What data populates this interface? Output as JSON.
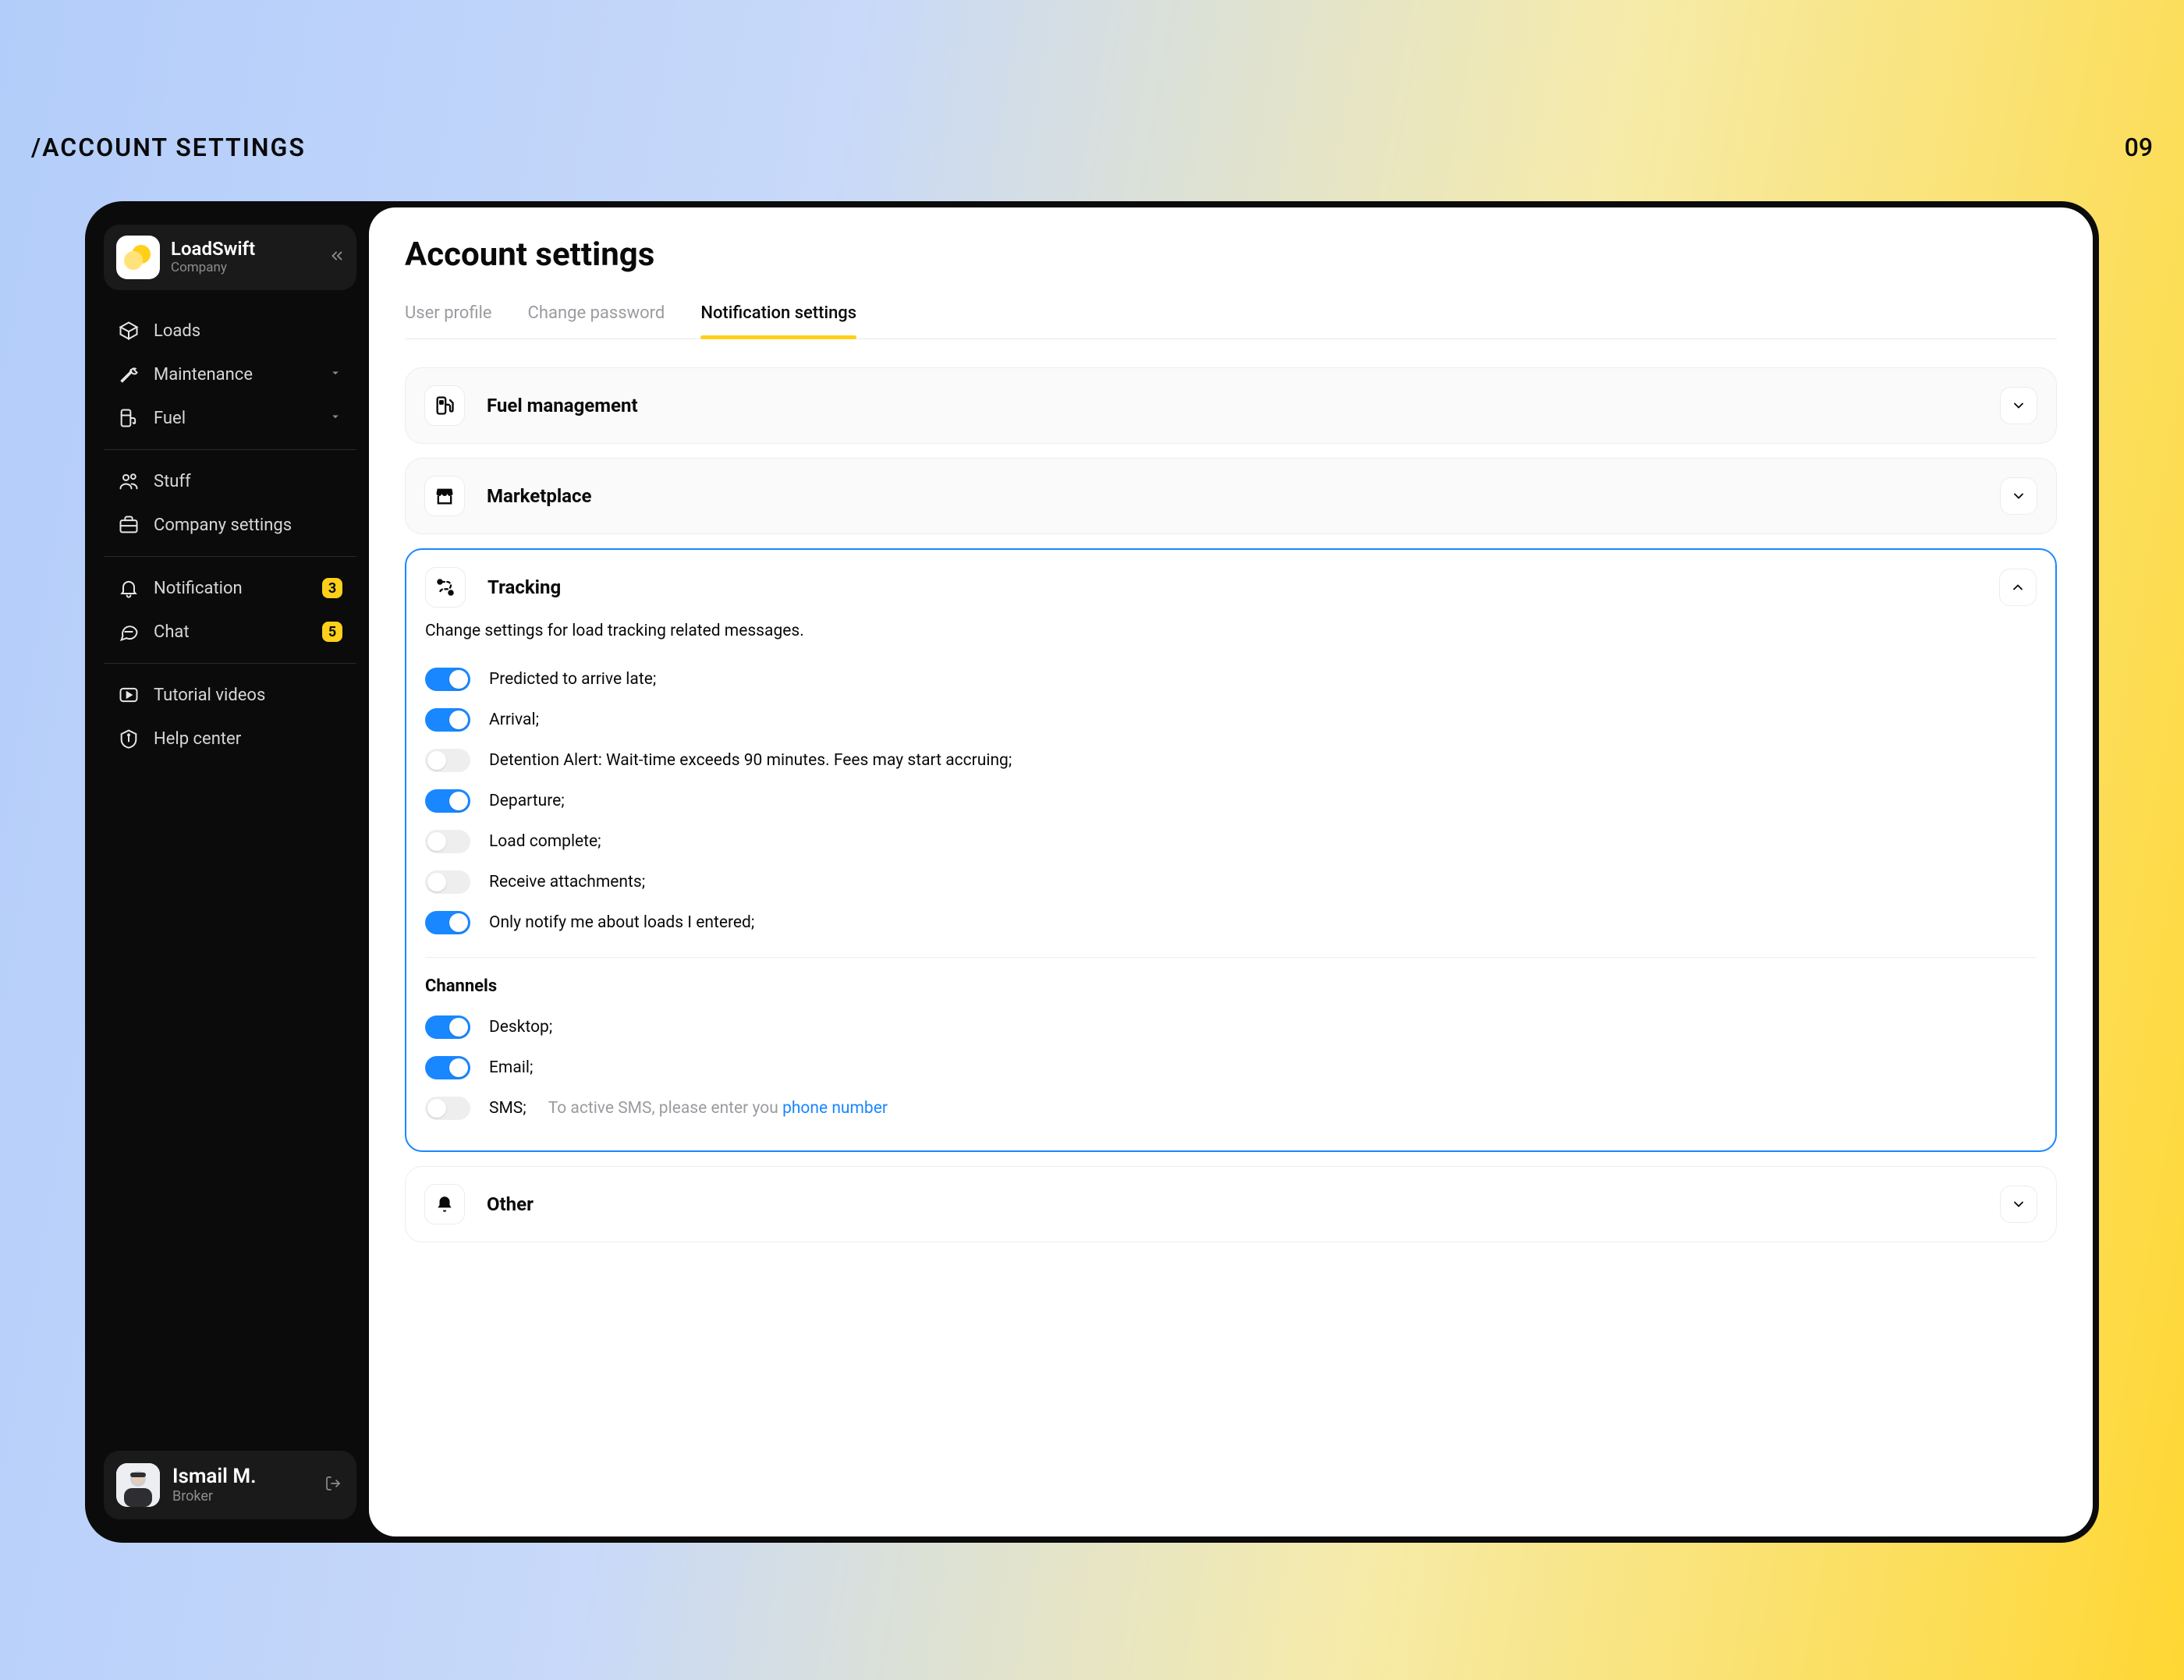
{
  "outer": {
    "title": "/ACCOUNT SETTINGS",
    "page": "09"
  },
  "brand": {
    "name": "LoadSwift",
    "subtitle": "Company"
  },
  "nav": {
    "loads": "Loads",
    "maintenance": "Maintenance",
    "fuel": "Fuel",
    "stuff": "Stuff",
    "company_settings": "Company settings",
    "notification": "Notification",
    "notification_badge": "3",
    "chat": "Chat",
    "chat_badge": "5",
    "tutorials": "Tutorial videos",
    "help": "Help center"
  },
  "user": {
    "name": "Ismail M.",
    "role": "Broker"
  },
  "main": {
    "title": "Account settings",
    "tabs": {
      "profile": "User profile",
      "password": "Change password",
      "notif": "Notification settings"
    },
    "sections": {
      "fuel": "Fuel management",
      "marketplace": "Marketplace",
      "tracking": "Tracking",
      "tracking_desc": "Change settings for load tracking related messages.",
      "other": "Other",
      "channels": "Channels"
    },
    "tracking_toggles": {
      "late": "Predicted to arrive late;",
      "arrival": "Arrival;",
      "detention": "Detention Alert: Wait-time exceeds 90 minutes. Fees may start accruing;",
      "departure": "Departure;",
      "complete": "Load complete;",
      "attachments": "Receive attachments;",
      "own_loads": "Only notify me about loads I entered;"
    },
    "channels": {
      "desktop": "Desktop;",
      "email": "Email;",
      "sms": "SMS;",
      "sms_hint_pre": "To active SMS, please enter you ",
      "sms_hint_link": "phone number"
    }
  }
}
